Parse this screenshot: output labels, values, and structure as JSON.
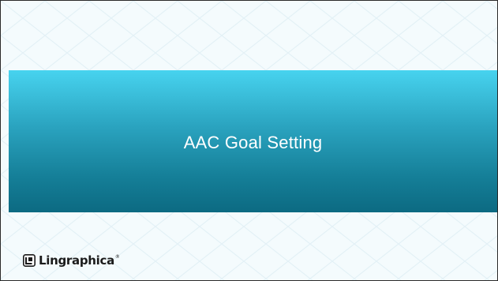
{
  "slide": {
    "title": "AAC Goal Setting"
  },
  "logo": {
    "name": "Lingraphica",
    "registered_mark": "®",
    "icon": "lingraphica-logo-icon"
  },
  "colors": {
    "band_top": "#47d3ef",
    "band_bottom": "#0c6a82",
    "title_text": "#ffffff",
    "background": "#f4fbfd"
  }
}
